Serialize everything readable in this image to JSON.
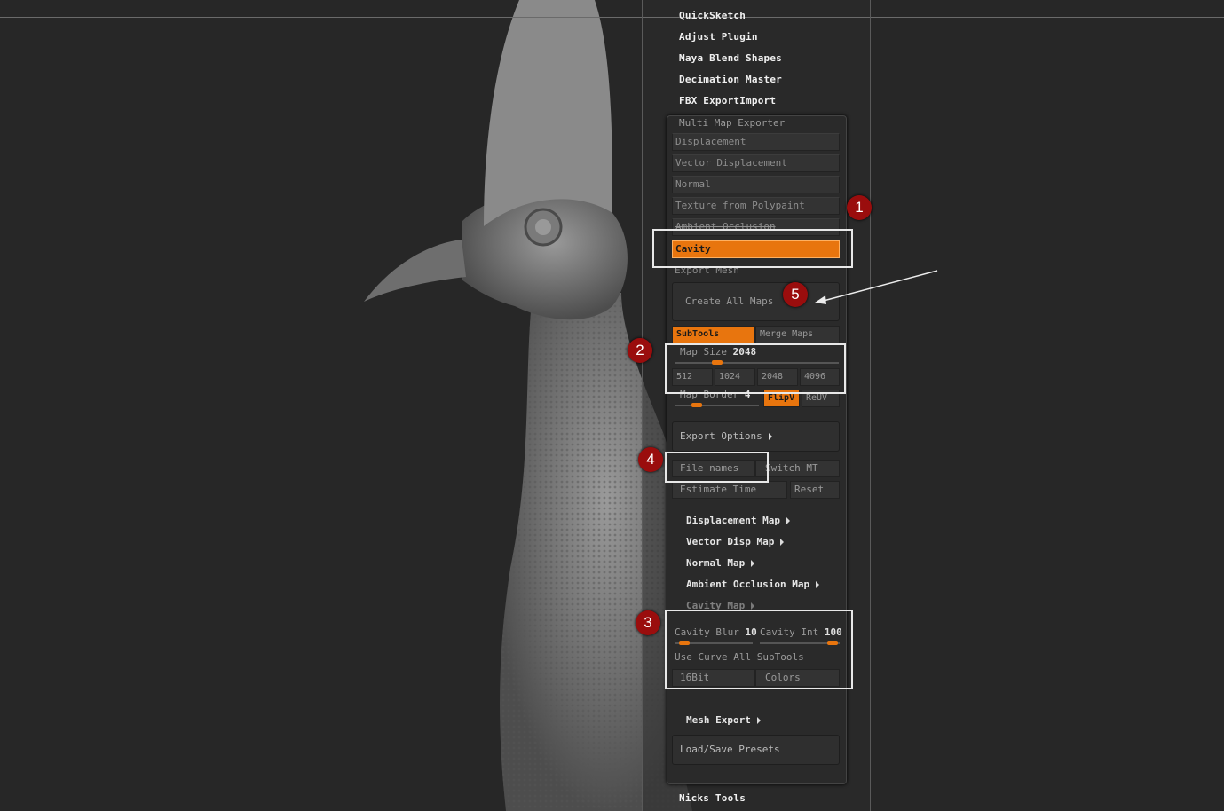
{
  "plugins": [
    "QuickSketch",
    "Adjust Plugin",
    "Maya Blend Shapes",
    "Decimation Master",
    "FBX ExportImport"
  ],
  "mme": {
    "title": "Multi Map Exporter",
    "maps": [
      "Displacement",
      "Vector Displacement",
      "Normal",
      "Texture from Polypaint",
      "Ambient Occlusion",
      "Cavity"
    ],
    "export_mesh": "Export Mesh",
    "create_all": "Create All Maps",
    "subtools": "SubTools",
    "merge_maps": "Merge Maps",
    "map_size_label": "Map Size",
    "map_size_value": "2048",
    "sizes": [
      "512",
      "1024",
      "2048",
      "4096"
    ],
    "map_border_label": "Map Border",
    "map_border_value": "4",
    "flipv": "FlipV",
    "reuv": "ReUV",
    "export_options": "Export Options",
    "file_names": "File names",
    "switch_mt": "Switch MT",
    "estimate_time": "Estimate Time",
    "reset": "Reset",
    "submenus": [
      "Displacement Map",
      "Vector Disp Map",
      "Normal Map",
      "Ambient Occlusion Map"
    ],
    "cavity_map": "Cavity Map",
    "cavity_blur_label": "Cavity Blur",
    "cavity_blur_value": "10",
    "cavity_int_label": "Cavity Int",
    "cavity_int_value": "100",
    "use_curve": "Use Curve All SubTools",
    "bit16": "16Bit",
    "colors": "Colors",
    "mesh_export": "Mesh Export",
    "load_save": "Load/Save Presets"
  },
  "nicks_tools": "Nicks Tools",
  "markers": [
    "1",
    "2",
    "3",
    "4",
    "5"
  ],
  "colors": {
    "accent": "#e8750e",
    "marker": "#9a0d0d"
  }
}
